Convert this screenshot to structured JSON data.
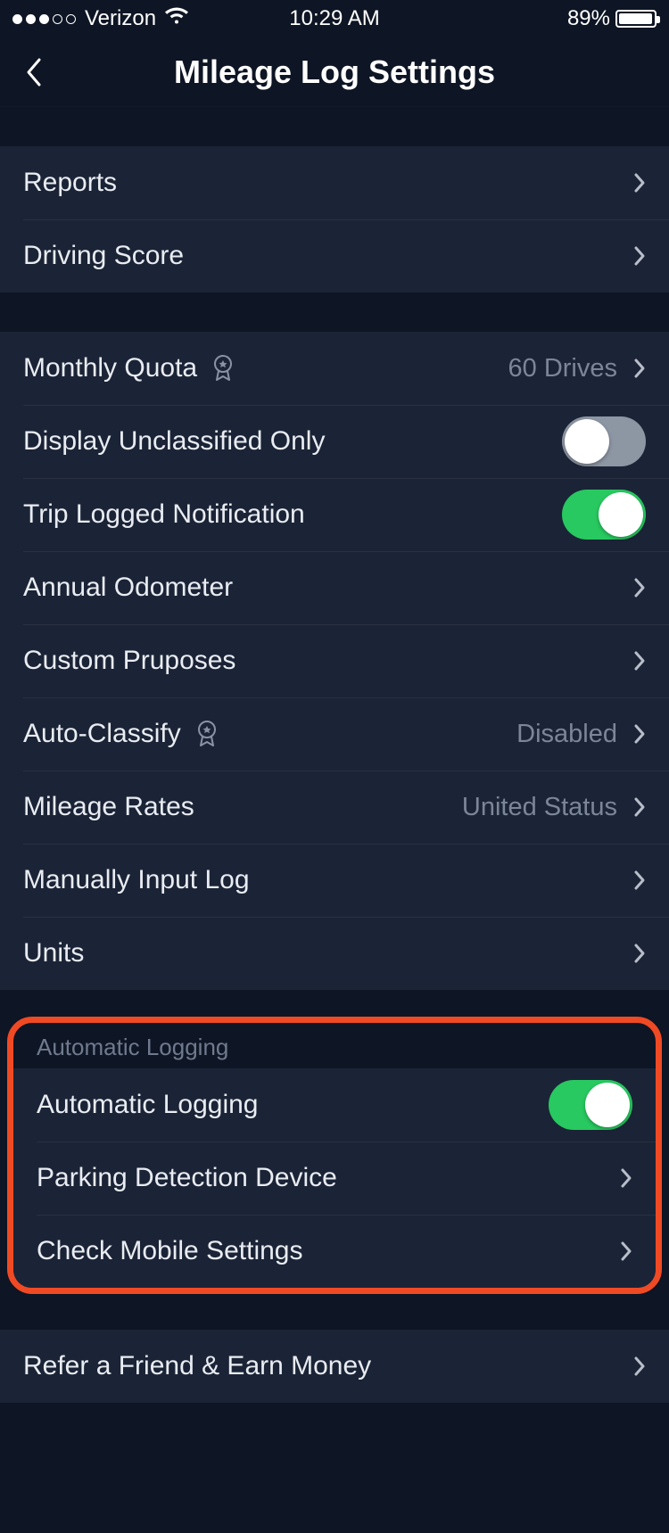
{
  "status_bar": {
    "carrier": "Verizon",
    "time": "10:29 AM",
    "battery_pct": "89%"
  },
  "nav": {
    "title": "Mileage Log Settings"
  },
  "section1": {
    "reports": "Reports",
    "driving_score": "Driving Score"
  },
  "section2": {
    "monthly_quota_label": "Monthly Quota",
    "monthly_quota_value": "60 Drives",
    "display_unclassified": "Display Unclassified Only",
    "trip_logged_notification": "Trip Logged Notification",
    "annual_odometer": "Annual Odometer",
    "custom_purposes": "Custom Pruposes",
    "auto_classify_label": "Auto-Classify",
    "auto_classify_value": "Disabled",
    "mileage_rates_label": "Mileage Rates",
    "mileage_rates_value": "United Status",
    "manual_input": "Manually Input Log",
    "units": "Units"
  },
  "section3": {
    "header": "Automatic Logging",
    "automatic_logging": "Automatic Logging",
    "parking_detection": "Parking Detection Device",
    "check_mobile": "Check Mobile Settings"
  },
  "section4": {
    "refer": "Refer a Friend & Earn Money"
  },
  "toggles": {
    "display_unclassified_only": false,
    "trip_logged_notification": true,
    "automatic_logging": true
  }
}
